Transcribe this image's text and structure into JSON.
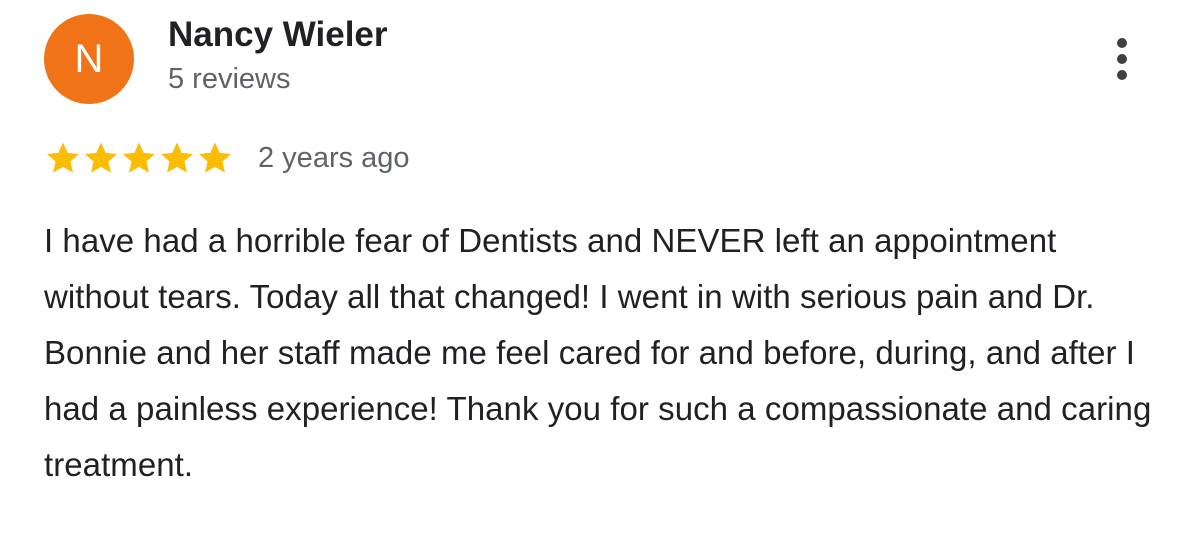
{
  "review": {
    "avatar_initial": "N",
    "avatar_color": "#f07318",
    "author_name": "Nancy Wieler",
    "author_review_count": "5 reviews",
    "rating": 5,
    "rating_max": 5,
    "star_color": "#fbbc04",
    "time_ago": "2 years ago",
    "text": "I have had a horrible fear of Dentists and NEVER left an appointment without tears. Today all that changed! I went in with serious pain and Dr. Bonnie and her staff made me feel cared for and before, during, and after I had a painless experience! Thank you for such a compassionate and caring treatment.",
    "more_options_icon": "more-vert-icon"
  }
}
